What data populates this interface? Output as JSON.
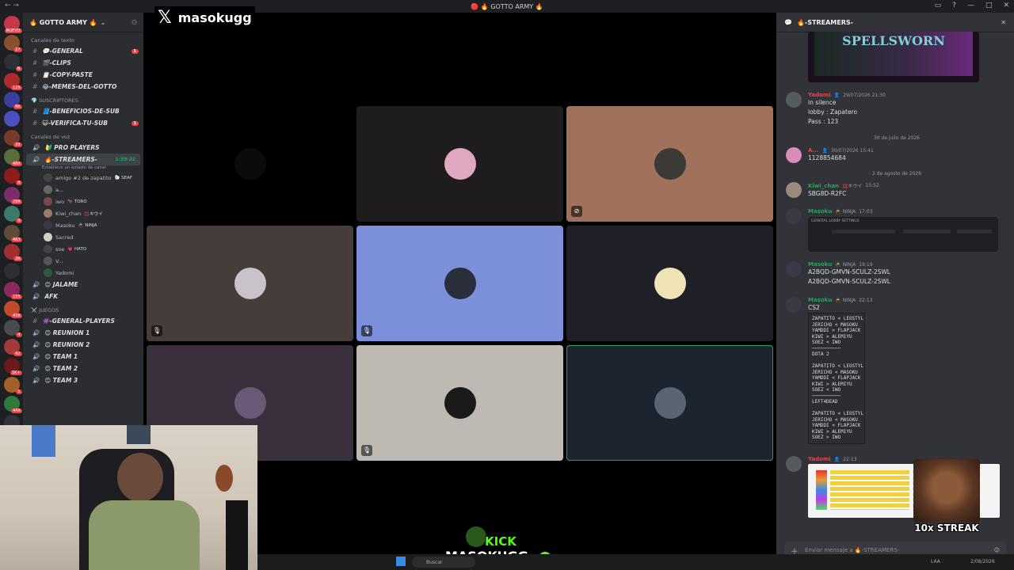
{
  "window": {
    "title": "🔴 🔥 GOTTO ARMY 🔥"
  },
  "servers": [
    {
      "color": "#c8364a",
      "badge": "NUEVO"
    },
    {
      "color": "#8a4f2f",
      "badge": "27"
    },
    {
      "color": "#2d3036",
      "badge": "N"
    },
    {
      "color": "#ac2b2b",
      "badge": "125"
    },
    {
      "color": "#3b3f9e",
      "badge": "86"
    },
    {
      "color": "#4b4fbf",
      "badge": ""
    },
    {
      "color": "#7a3a2a",
      "badge": "29"
    },
    {
      "color": "#5a6d3a",
      "badge": "480"
    },
    {
      "color": "#8c1b1b",
      "badge": "9"
    },
    {
      "color": "#7b2c6b",
      "badge": "298"
    },
    {
      "color": "#3c7a6a",
      "badge": "9"
    },
    {
      "color": "#5e4b3a",
      "badge": "463"
    },
    {
      "color": "#a03030",
      "badge": "26"
    },
    {
      "color": "#2f2f33",
      "badge": ""
    },
    {
      "color": "#8a2a5c",
      "badge": "155"
    },
    {
      "color": "#c04a2a",
      "badge": "438"
    },
    {
      "color": "#4a4a4f",
      "badge": "4"
    },
    {
      "color": "#a33a3a",
      "badge": "42"
    },
    {
      "color": "#6a1a1a",
      "badge": "1K+"
    },
    {
      "color": "#a3612a",
      "badge": "1"
    },
    {
      "color": "#2f7a3a",
      "badge": "449"
    },
    {
      "color": "#313338",
      "badge": "20"
    }
  ],
  "sidebar": {
    "guild_name": "🔥 GOTTO ARMY 🔥",
    "cat_text": "Canales de texto",
    "text_channels": [
      {
        "name": "💬-GENERAL",
        "badge": "1"
      },
      {
        "name": "🎬-CLIPS",
        "badge": ""
      },
      {
        "name": "📋-COPY-PASTE",
        "badge": ""
      },
      {
        "name": "😂-MEMES-DEL-GOTTO",
        "badge": ""
      }
    ],
    "cat_subs": "💎 SUSCRIPTORES",
    "sub_channels": [
      {
        "name": "📘-BENEFICIOS-DE-SUB",
        "badge": ""
      },
      {
        "name": "😺-VERIFICA-TU-SUB",
        "badge": "1"
      }
    ],
    "cat_voice": "Canales de voz",
    "voice_top": "🔰 PRO PLAYERS",
    "active_voice": {
      "name": "🔥-STREAMERS-",
      "timer": "1:39:22",
      "status": "Establece un estado de canal"
    },
    "voice_users": [
      {
        "name": "amigo #2 de zapatito",
        "tag": "🐑 SEAF",
        "color": "#444"
      },
      {
        "name": "a...",
        "tag": "",
        "color": "#666"
      },
      {
        "name": "iwo",
        "tag": "🐂 TORO",
        "color": "#7a4a4a"
      },
      {
        "name": "Kiwi_chan",
        "tag": "💢キウイ",
        "color": "#9a7a6a"
      },
      {
        "name": "Masoku",
        "tag": "🥷 NINJA",
        "color": "#3a3a46"
      },
      {
        "name": "Sacred",
        "tag": "",
        "color": "#d6d0c2"
      },
      {
        "name": "soe",
        "tag": "💗 HATO",
        "color": "#444"
      },
      {
        "name": "V...",
        "tag": "",
        "color": "#555"
      },
      {
        "name": "Yadomi",
        "tag": "",
        "color": "#2f5a3a"
      }
    ],
    "voice_more": [
      "😊 JALAME",
      "AFK"
    ],
    "cat_games": "⚔️ JUEGOS",
    "game_channels": [
      "👾-GENERAL-PLAYERS",
      "😊 REUNION 1",
      "😊 REUNION 2",
      "😊 TEAM 1",
      "😊 TEAM 2",
      "😊 TEAM 3"
    ]
  },
  "stage": {
    "handle": "masokugg",
    "tiles": [
      {
        "bg": "#000000",
        "av": "#0b0b0b",
        "muted": false,
        "cam": false,
        "active": false
      },
      {
        "bg": "#1e1c1d",
        "av": "#e0a8c0",
        "muted": false,
        "cam": false,
        "active": false
      },
      {
        "bg": "#a1725b",
        "av": "#3b3a36",
        "muted": false,
        "cam": true,
        "active": false
      },
      {
        "bg": "#463d3a",
        "av": "#c9c2ca",
        "muted": true,
        "cam": false,
        "active": false
      },
      {
        "bg": "#7b8fdb",
        "av": "#2a2d3a",
        "muted": true,
        "cam": false,
        "active": false
      },
      {
        "bg": "#1e1f27",
        "av": "#efe2b5",
        "muted": false,
        "cam": false,
        "active": false
      },
      {
        "bg": "#3a2f3d",
        "av": "#6a5a78",
        "muted": false,
        "cam": false,
        "active": false
      },
      {
        "bg": "#bebab3",
        "av": "#1a1a1a",
        "muted": true,
        "cam": false,
        "active": false
      },
      {
        "bg": "#1c2430",
        "av": "#5a6472",
        "muted": false,
        "cam": false,
        "active": true
      }
    ]
  },
  "chat": {
    "title": "🔥-STREAMERS-",
    "image_caption": "SPELLSWORN",
    "m1": {
      "name": "Yadomi",
      "time": "29/07/2026 21:30",
      "lines": [
        "in silence",
        "lobby : Zapatero",
        "Pass : 123"
      ]
    },
    "d1": "30 de julio de 2026",
    "m2": {
      "name": "A...",
      "time": "30/07/2026 15:41",
      "lines": [
        "1128854684"
      ]
    },
    "d2": "2 de agosto de 2026",
    "m3": {
      "name": "Kiwi_chan",
      "tag": "💢キウイ",
      "time": "15:52",
      "lines": [
        "SBG8D-R2FC"
      ]
    },
    "m4": {
      "name": "Masoku",
      "tag": "🥷 NINJA",
      "time": "17:03",
      "caption": "GENERAL LOBBY SETTINGS"
    },
    "m5": {
      "name": "Masoku",
      "tag": "🥷 NINJA",
      "time": "19:19",
      "lines": [
        "A2BQD-GMVN-SCULZ-2SWL",
        "A2BQD-GMVN-SCULZ-2SWL"
      ]
    },
    "m6": {
      "name": "Masoku",
      "tag": "🥷 NINJA",
      "time": "22:13",
      "first": "CS2",
      "code": "ZAPATITO < LEOSTYL\nJERICHO < MASOKU\nYAMDDI > FLAPJACK\nKIWI > ALEMIYU\nSOEZ < IWO\n──────────\nDOTA 2\n\nZAPATITO < LEOSTYL\nJERICHO < MASOKU\nYAMDDI < FLAPJACK\nKIWI > ALEMIYU\nSOEZ < IWO\n──────────\nLEFT4DEAD\n\nZAPATITO < LEOSTYL\nJERICHO < MASOKU\nYAMDDI < FLAPJACK\nKIWI > ALEMIYU\nSOEZ > IWO"
    },
    "m7": {
      "name": "Yadomi",
      "time": "22:13"
    },
    "composer_placeholder": "Enviar mensaje a 🔥-STREAMERS-",
    "streak": "10x STREAK"
  },
  "overlay": {
    "kick_top": "KICK",
    "kick_bottom": "MASOKUGG"
  },
  "taskbar": {
    "search": "Buscar",
    "lang": "LAA",
    "date": "2/08/2026"
  }
}
